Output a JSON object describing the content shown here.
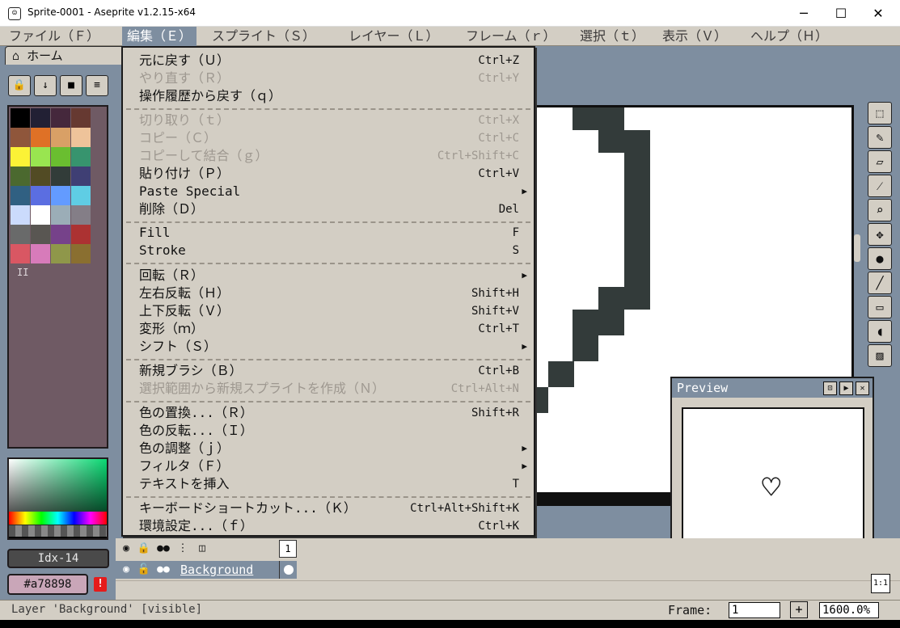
{
  "window": {
    "title": "Sprite-0001 - Aseprite v1.2.15-x64",
    "minimize": "─",
    "maximize": "☐",
    "close": "✕"
  },
  "menubar": [
    "ファイル（Ｆ）",
    "編集（Ｅ）",
    "スプライト（Ｓ）",
    "レイヤー（Ｌ）",
    "フレーム（ｒ）",
    "選択（ｔ）",
    "表示（Ｖ）",
    "ヘルプ（Ｈ）"
  ],
  "tabs": {
    "home": "ホーム"
  },
  "palette_index": "Idx-14",
  "color_hex": "#a78898",
  "colors": [
    "#000000",
    "#222034",
    "#45283c",
    "#663931",
    "#8f563b",
    "#df7126",
    "#d9a066",
    "#eec39a",
    "#fbf236",
    "#99e550",
    "#6abe30",
    "#37946e",
    "#4b692f",
    "#524b24",
    "#323c39",
    "#3f3f74",
    "#306082",
    "#5b6ee1",
    "#639bff",
    "#5fcde4",
    "#cbdbfc",
    "#ffffff",
    "#9badb7",
    "#847e87",
    "#696a6a",
    "#595652",
    "#76428a",
    "#ac3232",
    "#d95763",
    "#d77bba",
    "#8f974a",
    "#8a6f30"
  ],
  "edit_menu": {
    "undo": {
      "label": "元に戻す（Ｕ）",
      "shortcut": "Ctrl+Z"
    },
    "redo": {
      "label": "やり直す（Ｒ）",
      "shortcut": "Ctrl+Y"
    },
    "undo_history": {
      "label": "操作履歴から戻す（ｑ）",
      "shortcut": ""
    },
    "cut": {
      "label": "切り取り（ｔ）",
      "shortcut": "Ctrl+X"
    },
    "copy": {
      "label": "コピー（Ｃ）",
      "shortcut": "Ctrl+C"
    },
    "copy_merged": {
      "label": "コピーして結合（ｇ）",
      "shortcut": "Ctrl+Shift+C"
    },
    "paste": {
      "label": "貼り付け（Ｐ）",
      "shortcut": "Ctrl+V"
    },
    "paste_special": {
      "label": "Paste Special",
      "shortcut": ""
    },
    "delete": {
      "label": "削除（Ｄ）",
      "shortcut": "Del"
    },
    "fill": {
      "label": "Fill",
      "shortcut": "F"
    },
    "stroke": {
      "label": "Stroke",
      "shortcut": "S"
    },
    "rotate": {
      "label": "回転（Ｒ）",
      "shortcut": ""
    },
    "flip_h": {
      "label": "左右反転（Ｈ）",
      "shortcut": "Shift+H"
    },
    "flip_v": {
      "label": "上下反転（Ｖ）",
      "shortcut": "Shift+V"
    },
    "transform": {
      "label": "変形（ｍ）",
      "shortcut": "Ctrl+T"
    },
    "shift": {
      "label": "シフト（Ｓ）",
      "shortcut": ""
    },
    "new_brush": {
      "label": "新規ブラシ（Ｂ）",
      "shortcut": "Ctrl+B"
    },
    "new_sprite": {
      "label": "選択範囲から新規スプライトを作成（Ｎ）",
      "shortcut": "Ctrl+Alt+N"
    },
    "replace_color": {
      "label": "色の置換...（Ｒ）",
      "shortcut": "Shift+R"
    },
    "invert_color": {
      "label": "色の反転...（Ｉ）",
      "shortcut": ""
    },
    "adjustments": {
      "label": "色の調整（ｊ）",
      "shortcut": ""
    },
    "filters": {
      "label": "フィルタ（Ｆ）",
      "shortcut": ""
    },
    "insert_text": {
      "label": "テキストを挿入",
      "shortcut": "T"
    },
    "keyboard_shortcuts": {
      "label": "キーボードショートカット...（Ｋ）",
      "shortcut": "Ctrl+Alt+Shift+K"
    },
    "preferences": {
      "label": "環境設定...（ｆ）",
      "shortcut": "Ctrl+K"
    }
  },
  "preview": {
    "title": "Preview"
  },
  "timeline": {
    "frame_number": "1",
    "layer_name": "Background"
  },
  "statusbar": {
    "text": "Layer 'Background' [visible]",
    "frame_label": "Frame:",
    "frame_value": "1",
    "add_frame": "+",
    "zoom": "1600.0%"
  },
  "side_frame": "1:1"
}
